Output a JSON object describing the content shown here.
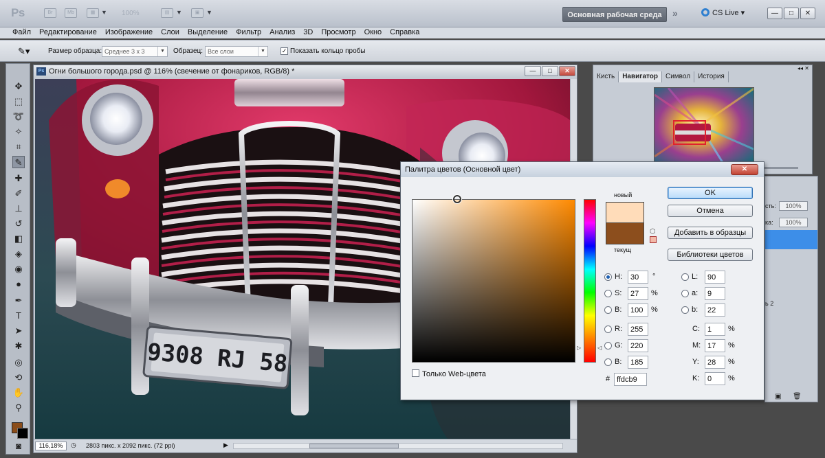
{
  "app": {
    "logo": "Ps",
    "bridge": "Br",
    "mini_bridge": "Mb",
    "zoom": "100%",
    "workspace": "Основная рабочая среда",
    "cslive": "CS Live"
  },
  "menu": [
    "Файл",
    "Редактирование",
    "Изображение",
    "Слои",
    "Выделение",
    "Фильтр",
    "Анализ",
    "3D",
    "Просмотр",
    "Окно",
    "Справка"
  ],
  "options": {
    "sample_size_label": "Размер образца:",
    "sample_size_value": "Среднее 3 x 3",
    "sample_label": "Образец:",
    "sample_value": "Все слои",
    "show_ring_label": "Показать кольцо пробы",
    "show_ring_checked": true
  },
  "document": {
    "title": "Огни большого города.psd @ 116% (свечение от фонариков, RGB/8) *",
    "zoom": "116,18%",
    "info": "2803 пикс. x 2092 пикс. (72 ppi)",
    "plate": "9308 RJ 58"
  },
  "panels": {
    "tabs": [
      "Кисть",
      "Навигатор",
      "Символ",
      "История"
    ],
    "active_tab": "Навигатор",
    "opacity": "100%",
    "fill": "100%",
    "fill_label": "ка:",
    "opacity_label": "сть:",
    "layer_suffix": "ь 2"
  },
  "color_picker": {
    "title": "Палитра цветов (Основной цвет)",
    "new_label": "новый",
    "current_label": "текущ",
    "new_color": "#ffdcb9",
    "current_color": "#8c4e1d",
    "ok": "OK",
    "cancel": "Отмена",
    "add_to_swatches": "Добавить в образцы",
    "color_libraries": "Библиотеки цветов",
    "web_only": "Только Web-цвета",
    "fields": {
      "H": "30",
      "S": "27",
      "B": "100",
      "R": "255",
      "G": "220",
      "Bb": "185",
      "L": "90",
      "a": "9",
      "b": "22",
      "C": "1",
      "M": "17",
      "Y": "28",
      "K": "0"
    },
    "units": {
      "deg": "°",
      "pct": "%"
    },
    "hex_label": "#",
    "hex": "ffdcb9"
  }
}
